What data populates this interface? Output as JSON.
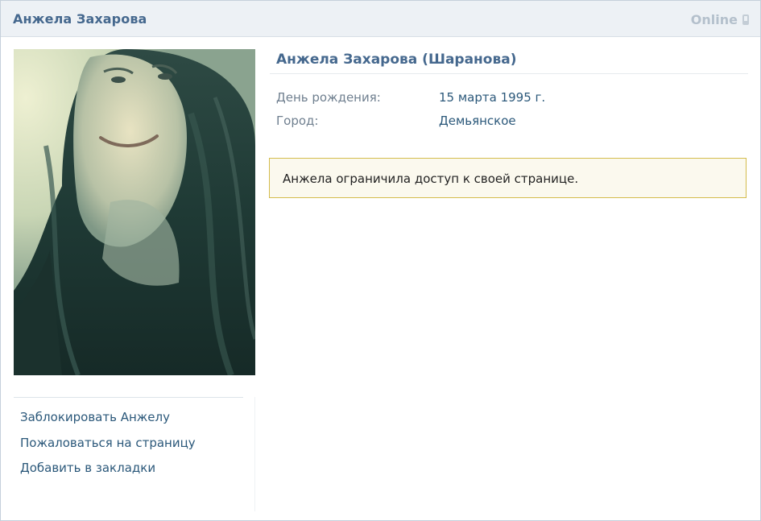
{
  "header": {
    "name": "Анжела Захарова",
    "status": "Online",
    "status_icon": "mobile-phone-icon"
  },
  "profile": {
    "full_name": "Анжела Захарова (Шаранова)",
    "birthday_label": "День рождения:",
    "birthday_value": "15 марта 1995 г.",
    "city_label": "Город:",
    "city_value": "Демьянское"
  },
  "notice": {
    "text": "Анжела ограничила доступ к своей странице."
  },
  "actions": [
    "Заблокировать Анжелу",
    "Пожаловаться на страницу",
    "Добавить в закладки"
  ],
  "colors": {
    "link": "#2b587a",
    "header_bg": "#edf1f5",
    "name_blue": "#45688e",
    "notice_bg": "#fbf9ee",
    "notice_border": "#d4bc4c"
  }
}
